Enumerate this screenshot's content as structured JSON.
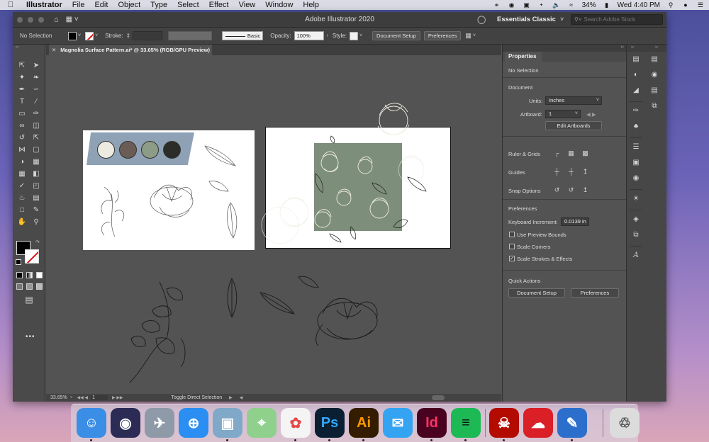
{
  "menubar": {
    "apple_icon": "apple-logo",
    "app_name": "Illustrator",
    "items": [
      "File",
      "Edit",
      "Object",
      "Type",
      "Select",
      "Effect",
      "View",
      "Window",
      "Help"
    ],
    "battery": "34%",
    "clock": "Wed 4:40 PM"
  },
  "window": {
    "title": "Adobe Illustrator 2020",
    "workspace": "Essentials Classic",
    "search_placeholder": "Search Adobe Stock"
  },
  "controlbar": {
    "selection": "No Selection",
    "stroke_label": "Stroke:",
    "brush": "Basic",
    "opacity_label": "Opacity:",
    "opacity_value": "100%",
    "style_label": "Style:",
    "document_setup": "Document Setup",
    "preferences": "Preferences"
  },
  "document": {
    "tab_title": "Magnolia Surface Pattern.ai* @ 33.65% (RGB/GPU Preview)",
    "palette_colors": [
      "#eceae1",
      "#6b5d55",
      "#8d9c87",
      "#2a2d28"
    ],
    "pattern_color": "#7d8e7a"
  },
  "statusbar": {
    "zoom": "33.65%",
    "artboard": "1",
    "status": "Toggle Direct Selection"
  },
  "properties": {
    "tab": "Properties",
    "no_selection": "No Selection",
    "document_heading": "Document",
    "units_label": "Units:",
    "units_value": "Inches",
    "artboard_label": "Artboard:",
    "artboard_value": "1",
    "edit_artboards": "Edit Artboards",
    "rulers_grids": "Ruler & Grids",
    "guides": "Guides",
    "snap_options": "Snap Options",
    "preferences_heading": "Preferences",
    "keyboard_increment_label": "Keyboard Increment:",
    "keyboard_increment_value": "0.0139 in",
    "use_preview_bounds": "Use Preview Bounds",
    "scale_corners": "Scale Corners",
    "scale_strokes_effects": "Scale Strokes & Effects",
    "quick_actions": "Quick Actions",
    "document_setup_button": "Document Setup",
    "preferences_button": "Preferences"
  },
  "dock": {
    "apps": [
      {
        "name": "Finder",
        "icon": "finder-icon",
        "label": "",
        "bg": "#3a8ee6",
        "fg": "#ffffff"
      },
      {
        "name": "Siri",
        "icon": "siri-icon",
        "label": "",
        "bg": "#2b2b55",
        "fg": "#ffffff"
      },
      {
        "name": "Launchpad",
        "icon": "launchpad-icon",
        "label": "",
        "bg": "#8e9aa8",
        "fg": "#ffffff"
      },
      {
        "name": "Safari",
        "icon": "safari-icon",
        "label": "",
        "bg": "#2a8ef2",
        "fg": "#ffffff"
      },
      {
        "name": "Preview",
        "icon": "preview-icon",
        "label": "",
        "bg": "#7fa8c9",
        "fg": "#ffffff"
      },
      {
        "name": "Maps",
        "icon": "maps-icon",
        "label": "",
        "bg": "#8fd08c",
        "fg": "#ffffff"
      },
      {
        "name": "Photos",
        "icon": "photos-icon",
        "label": "",
        "bg": "#f4f4f4",
        "fg": "#e34b4b"
      },
      {
        "name": "Photoshop",
        "icon": "photoshop-icon",
        "label": "Ps",
        "bg": "#0b1f33",
        "fg": "#31a8ff"
      },
      {
        "name": "Illustrator",
        "icon": "illustrator-icon",
        "label": "Ai",
        "bg": "#331c00",
        "fg": "#ff9a00"
      },
      {
        "name": "Messages",
        "icon": "messages-icon",
        "label": "",
        "bg": "#34a4f2",
        "fg": "#ffffff"
      },
      {
        "name": "InDesign",
        "icon": "indesign-icon",
        "label": "Id",
        "bg": "#49021f",
        "fg": "#ff3366"
      },
      {
        "name": "Spotify",
        "icon": "spotify-icon",
        "label": "",
        "bg": "#1db954",
        "fg": "#111111"
      },
      {
        "name": "Acrobat",
        "icon": "acrobat-icon",
        "label": "",
        "bg": "#b30b00",
        "fg": "#ffffff"
      },
      {
        "name": "Creative Cloud",
        "icon": "creative-cloud-icon",
        "label": "",
        "bg": "#da1f26",
        "fg": "#ffffff"
      },
      {
        "name": "Script Editor",
        "icon": "script-editor-icon",
        "label": "",
        "bg": "#2c6ecb",
        "fg": "#ffffff"
      },
      {
        "name": "Trash",
        "icon": "trash-icon",
        "label": "",
        "bg": "#dcdcdc",
        "fg": "#555555"
      }
    ]
  }
}
